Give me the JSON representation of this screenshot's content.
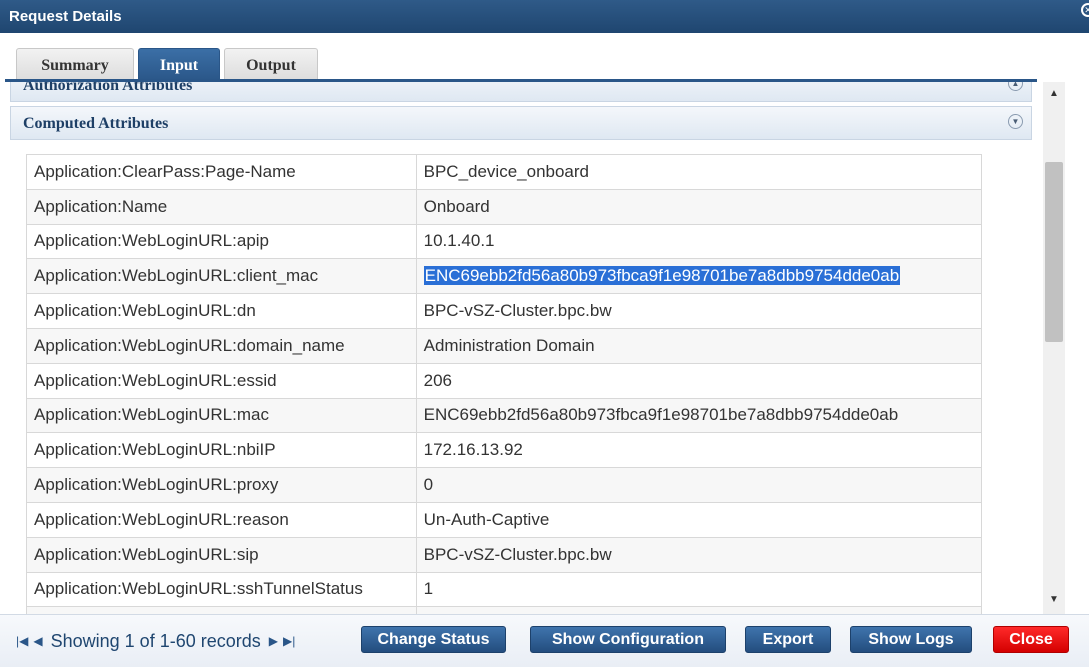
{
  "window": {
    "title": "Request Details"
  },
  "tabs": [
    {
      "label": "Summary",
      "active": false
    },
    {
      "label": "Input",
      "active": true
    },
    {
      "label": "Output",
      "active": false
    }
  ],
  "sections": {
    "authorization": "Authorization Attributes",
    "computed": "Computed Attributes"
  },
  "attributes": [
    {
      "key": "Application:ClearPass:Page-Name",
      "value": "BPC_device_onboard"
    },
    {
      "key": "Application:Name",
      "value": "Onboard"
    },
    {
      "key": "Application:WebLoginURL:apip",
      "value": "10.1.40.1"
    },
    {
      "key": "Application:WebLoginURL:client_mac",
      "value": "ENC69ebb2fd56a80b973fbca9f1e98701be7a8dbb9754dde0ab",
      "selected": true
    },
    {
      "key": "Application:WebLoginURL:dn",
      "value": "BPC-vSZ-Cluster.bpc.bw"
    },
    {
      "key": "Application:WebLoginURL:domain_name",
      "value": "Administration Domain"
    },
    {
      "key": "Application:WebLoginURL:essid",
      "value": "206"
    },
    {
      "key": "Application:WebLoginURL:mac",
      "value": "ENC69ebb2fd56a80b973fbca9f1e98701be7a8dbb9754dde0ab"
    },
    {
      "key": "Application:WebLoginURL:nbiIP",
      "value": "172.16.13.92"
    },
    {
      "key": "Application:WebLoginURL:proxy",
      "value": "0"
    },
    {
      "key": "Application:WebLoginURL:reason",
      "value": "Un-Auth-Captive"
    },
    {
      "key": "Application:WebLoginURL:sip",
      "value": "BPC-vSZ-Cluster.bpc.bw"
    },
    {
      "key": "Application:WebLoginURL:sshTunnelStatus",
      "value": "1"
    },
    {
      "key": "",
      "value": ""
    }
  ],
  "footer": {
    "pager_text": "Showing 1 of 1-60 records",
    "buttons": {
      "change_status": "Change Status",
      "show_configuration": "Show Configuration",
      "export": "Export",
      "show_logs": "Show Logs",
      "close": "Close"
    }
  },
  "colors": {
    "brand": "#1f4670",
    "selection": "#2a6fd6",
    "close_button": "#e00000"
  }
}
